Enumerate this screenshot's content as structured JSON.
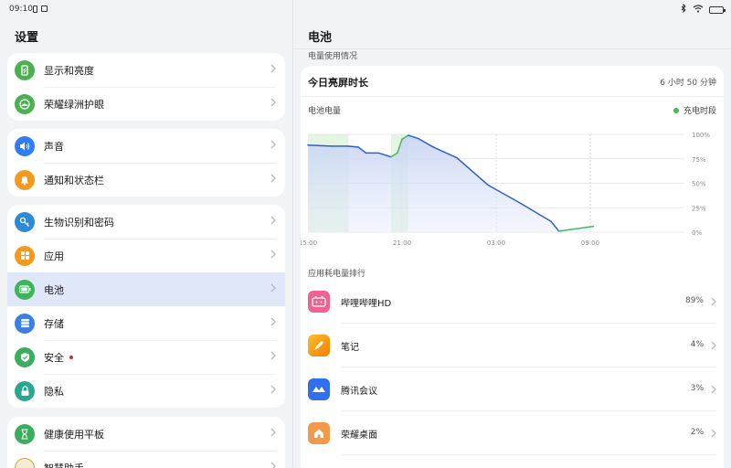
{
  "status": {
    "time": "09:10"
  },
  "left": {
    "title": "设置",
    "groups": [
      [
        {
          "label": "显示和亮度",
          "icon": "display-icon",
          "color": "#4caf50"
        },
        {
          "label": "荣耀绿洲护眼",
          "icon": "eye-care-icon",
          "color": "#4caf50"
        }
      ],
      [
        {
          "label": "声音",
          "icon": "sound-icon",
          "color": "#2f7cf6"
        },
        {
          "label": "通知和状态栏",
          "icon": "bell-icon",
          "color": "#f29a1f"
        }
      ],
      [
        {
          "label": "生物识别和密码",
          "icon": "key-icon",
          "color": "#2b8bd4"
        },
        {
          "label": "应用",
          "icon": "apps-icon",
          "color": "#f29a1f"
        },
        {
          "label": "电池",
          "icon": "battery-icon",
          "color": "#3db55a",
          "selected": true
        },
        {
          "label": "存储",
          "icon": "storage-icon",
          "color": "#3a7ee8"
        },
        {
          "label": "安全",
          "icon": "shield-icon",
          "color": "#3aae5c",
          "dot": true
        },
        {
          "label": "隐私",
          "icon": "lock-icon",
          "color": "#2aa88f"
        }
      ],
      [
        {
          "label": "健康使用平板",
          "icon": "hourglass-icon",
          "color": "#3aae5c"
        },
        {
          "label": "智慧助手",
          "icon": "assistant-icon",
          "color": "#c9a441"
        }
      ]
    ]
  },
  "right": {
    "title": "电池",
    "usage_section": "电量使用情况",
    "screen_time_label": "今日亮屏时长",
    "screen_time_value": "6 小时 50 分钟",
    "chart_label": "电池电量",
    "legend_label": "充电时段",
    "ranking_label": "应用耗电量排行",
    "apps": [
      {
        "name": "哔哩哔哩HD",
        "pct": "89%",
        "icon": "bilibili-icon",
        "color": "#f06292"
      },
      {
        "name": "笔记",
        "pct": "4%",
        "icon": "notes-icon",
        "color": "#f7a91b"
      },
      {
        "name": "腾讯会议",
        "pct": "3%",
        "icon": "tencent-meeting-icon",
        "color": "#2f6ff0"
      },
      {
        "name": "荣耀桌面",
        "pct": "2%",
        "icon": "home-launcher-icon",
        "color": "#f29a4a"
      }
    ]
  },
  "chart_data": {
    "type": "area",
    "title": "电池电量",
    "x_ticks": [
      "15:00",
      "21:00",
      "03:00",
      "09:00"
    ],
    "y_ticks": [
      "100%",
      "75%",
      "50%",
      "25%",
      "0%"
    ],
    "ylim": [
      0,
      100
    ],
    "x_hours": [
      0,
      1.5,
      2.5,
      3.2,
      3.7,
      4.5,
      5.3,
      5.7,
      6.0,
      6.4,
      7.0,
      8.0,
      9.5,
      11.5,
      13.5,
      15.5,
      16.0,
      18.2
    ],
    "battery_level": [
      89,
      88,
      88,
      87,
      81,
      81,
      77,
      81,
      95,
      99,
      96,
      87,
      76,
      48,
      30,
      11,
      1,
      6
    ],
    "charging_periods": [
      [
        0,
        2.0
      ],
      [
        2.0,
        2.6
      ],
      [
        5.3,
        6.4
      ]
    ],
    "legend": [
      "充电时段"
    ],
    "line_color": "#2f5fcc",
    "charge_color": "#47b85a"
  }
}
